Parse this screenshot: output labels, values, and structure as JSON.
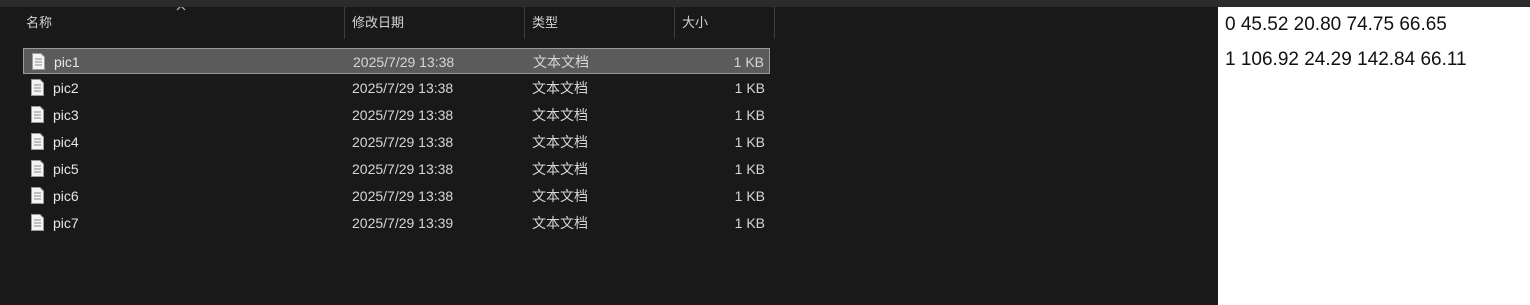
{
  "colors": {
    "background": "#191919",
    "selected_row": "#5b5b5b",
    "text": "#e6e6e6",
    "notes_background": "#ffffff"
  },
  "explorer": {
    "sort_icon": "chevron-up-icon",
    "file_icon": "text-document-icon",
    "columns": {
      "name": "名称",
      "date": "修改日期",
      "type": "类型",
      "size": "大小"
    },
    "files": [
      {
        "name": "pic1",
        "date": "2025/7/29 13:38",
        "type": "文本文档",
        "size": "1 KB",
        "selected": true
      },
      {
        "name": "pic2",
        "date": "2025/7/29 13:38",
        "type": "文本文档",
        "size": "1 KB",
        "selected": false
      },
      {
        "name": "pic3",
        "date": "2025/7/29 13:38",
        "type": "文本文档",
        "size": "1 KB",
        "selected": false
      },
      {
        "name": "pic4",
        "date": "2025/7/29 13:38",
        "type": "文本文档",
        "size": "1 KB",
        "selected": false
      },
      {
        "name": "pic5",
        "date": "2025/7/29 13:38",
        "type": "文本文档",
        "size": "1 KB",
        "selected": false
      },
      {
        "name": "pic6",
        "date": "2025/7/29 13:38",
        "type": "文本文档",
        "size": "1 KB",
        "selected": false
      },
      {
        "name": "pic7",
        "date": "2025/7/29 13:39",
        "type": "文本文档",
        "size": "1 KB",
        "selected": false
      }
    ]
  },
  "notes": {
    "lines": [
      "0 45.52 20.80 74.75 66.65",
      "1 106.92 24.29 142.84 66.11"
    ]
  }
}
